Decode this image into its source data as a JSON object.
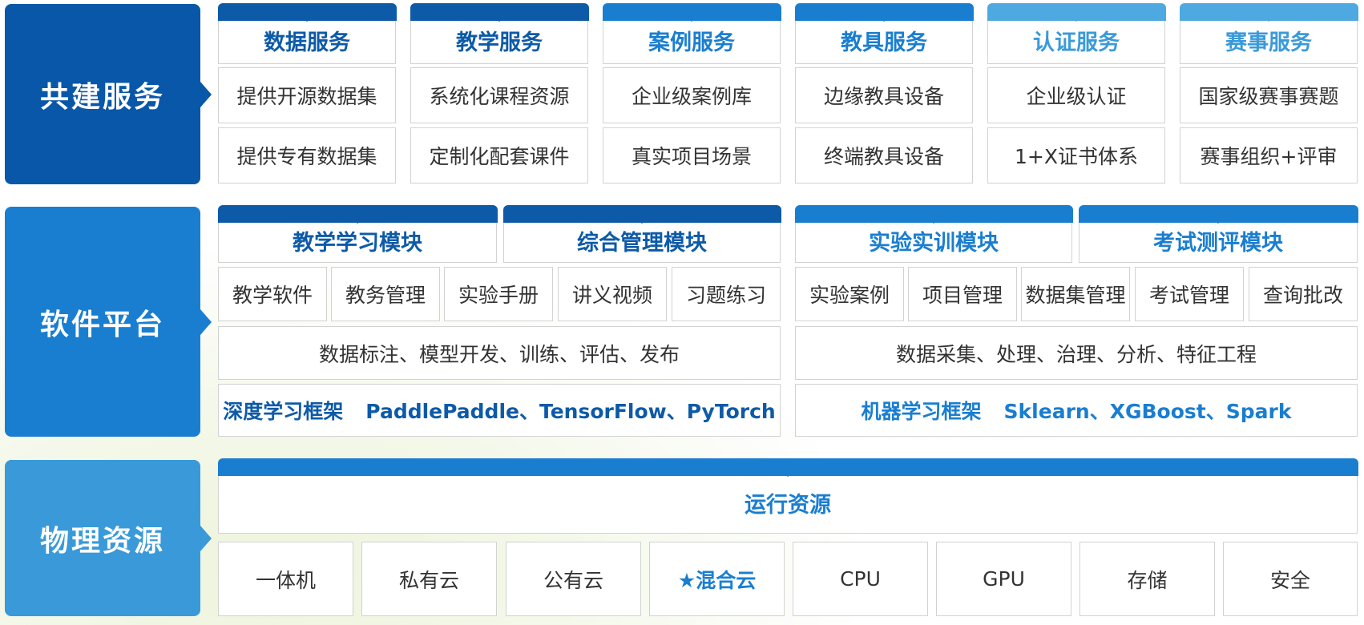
{
  "colors": {
    "dark_blue": "#0857a8",
    "mid_blue": "#1a7ed0",
    "light_blue": "#3a9ad9",
    "lighter_blue": "#4ea9e0"
  },
  "service_layer": {
    "title": "共建服务",
    "columns": [
      {
        "header": "数据服务",
        "items": [
          "提供开源数据集",
          "提供专有数据集"
        ]
      },
      {
        "header": "教学服务",
        "items": [
          "系统化课程资源",
          "定制化配套课件"
        ]
      },
      {
        "header": "案例服务",
        "items": [
          "企业级案例库",
          "真实项目场景"
        ]
      },
      {
        "header": "教具服务",
        "items": [
          "边缘教具设备",
          "终端教具设备"
        ]
      },
      {
        "header": "认证服务",
        "items": [
          "企业级认证",
          "1+X证书体系"
        ]
      },
      {
        "header": "赛事服务",
        "items": [
          "国家级赛事赛题",
          "赛事组织+评审"
        ]
      }
    ]
  },
  "software_layer": {
    "title": "软件平台",
    "modules": [
      "教学学习模块",
      "综合管理模块",
      "实验实训模块",
      "考试测评模块"
    ],
    "left_items": [
      "教学软件",
      "教务管理",
      "实验手册",
      "讲义视频",
      "习题练习"
    ],
    "right_items": [
      "实验案例",
      "项目管理",
      "数据集管理",
      "考试管理",
      "查询批改"
    ],
    "left_process": "数据标注、模型开发、训练、评估、发布",
    "right_process": "数据采集、处理、治理、分析、特征工程",
    "left_framework": {
      "label": "深度学习框架",
      "value": "PaddlePaddle、TensorFlow、PyTorch"
    },
    "right_framework": {
      "label": "机器学习框架",
      "value": "Sklearn、XGBoost、Spark"
    }
  },
  "physical_layer": {
    "title": "物理资源",
    "header": "运行资源",
    "items": [
      "一体机",
      "私有云",
      "公有云",
      "★混合云",
      "CPU",
      "GPU",
      "存储",
      "安全"
    ],
    "highlighted_index": 3
  }
}
